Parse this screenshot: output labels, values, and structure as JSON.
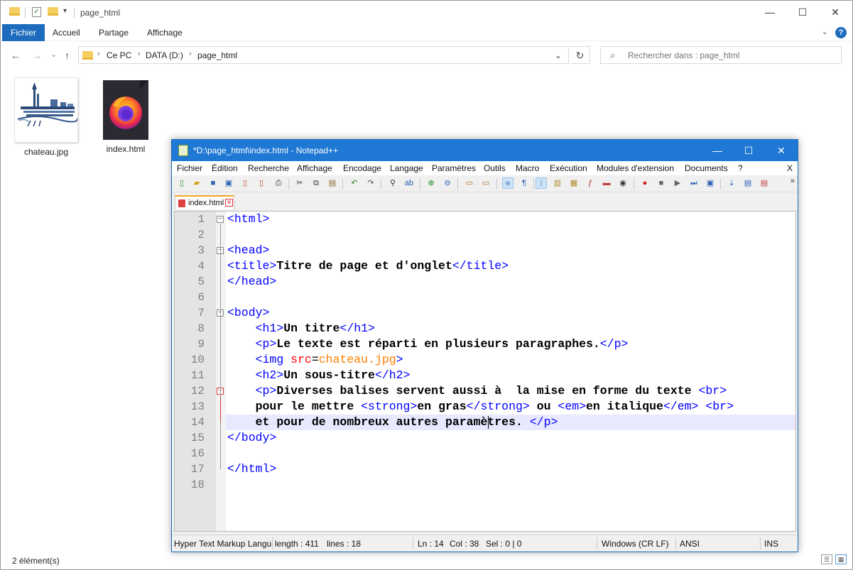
{
  "explorer": {
    "title": "page_html",
    "window_controls": {
      "minimize": "—",
      "maximize": "☐",
      "close": "✕"
    },
    "ribbon": {
      "tabs": [
        {
          "label": "Fichier"
        },
        {
          "label": "Accueil"
        },
        {
          "label": "Partage"
        },
        {
          "label": "Affichage"
        }
      ],
      "expand": "⌄",
      "help": "?"
    },
    "nav": {
      "back": "←",
      "forward": "→",
      "recent": "⌄",
      "up": "↑"
    },
    "address": {
      "crumbs": [
        "Ce PC",
        "DATA (D:)",
        "page_html"
      ],
      "separator": "›",
      "dropdown": "⌄",
      "refresh": "↻"
    },
    "search": {
      "placeholder": "Rechercher dans : page_html",
      "icon": "search-icon"
    },
    "files": [
      {
        "name": "chateau.jpg",
        "icon": "image-thumbnail"
      },
      {
        "name": "index.html",
        "icon": "firefox-icon"
      }
    ],
    "status": "2 élément(s)"
  },
  "npp": {
    "title": "*D:\\page_html\\index.html - Notepad++",
    "window_controls": {
      "minimize": "—",
      "maximize": "☐",
      "close": "✕"
    },
    "menu": [
      "Fichier",
      "Édition",
      "Recherche",
      "Affichage",
      "Encodage",
      "Langage",
      "Paramètres",
      "Outils",
      "Macro",
      "Exécution",
      "Modules d'extension",
      "Documents",
      "?"
    ],
    "menu_close": "X",
    "toolbar_overflow": "»",
    "tab": {
      "label": "index.html",
      "close": "✕"
    },
    "line_numbers": [
      "1",
      "2",
      "3",
      "4",
      "5",
      "6",
      "7",
      "8",
      "9",
      "10",
      "11",
      "12",
      "13",
      "14",
      "15",
      "16",
      "17",
      "18"
    ],
    "current_line": 14,
    "status": {
      "language": "Hyper Text Markup Langu",
      "length": "length : 411",
      "lines": "lines : 18",
      "ln": "Ln : 14",
      "col": "Col : 38",
      "sel": "Sel : 0 | 0",
      "eol": "Windows (CR LF)",
      "encoding": "ANSI",
      "mode": "INS"
    },
    "code_lines": [
      "<html>",
      "",
      "<head>",
      "<title>Titre de page et d'onglet</title>",
      "</head>",
      "",
      "<body>",
      "    <h1>Un titre</h1>",
      "    <p>Le texte est réparti en plusieurs paragraphes.</p>",
      "    <img src=chateau.jpg>",
      "    <h2>Un sous-titre</h2>",
      "    <p>Diverses balises servent aussi à  la mise en forme du texte <br>",
      "    pour le mettre <strong>en gras</strong> ou <em>en italique</em> <br>",
      "    et pour de nombreux autres paramètres. </p>",
      "</body>",
      "",
      "</html>",
      ""
    ]
  }
}
